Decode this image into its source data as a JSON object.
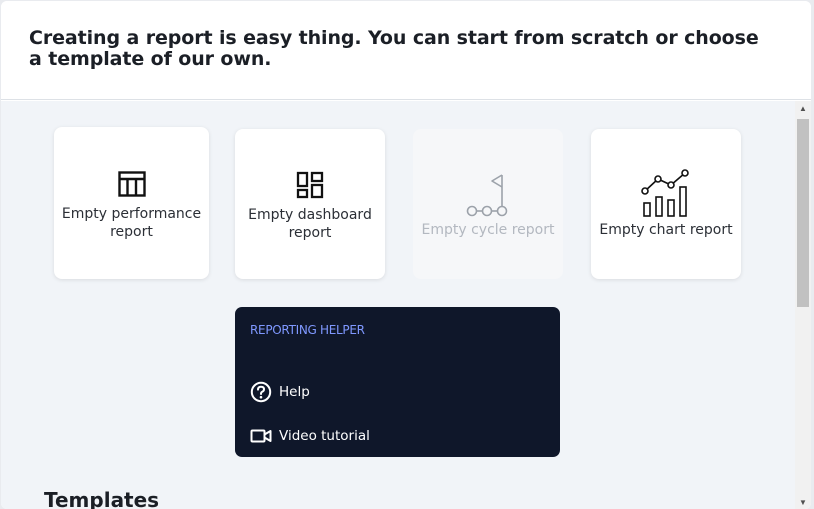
{
  "dialog": {
    "title": "Creating a report is easy thing. You can start from scratch or choose a template of our own."
  },
  "options": [
    {
      "label": "Empty performance report",
      "icon": "table-layout-icon",
      "enabled": true
    },
    {
      "label": "Empty dashboard report",
      "icon": "dashboard-grid-icon",
      "enabled": true
    },
    {
      "label": "Empty cycle report",
      "icon": "cycle-flag-icon",
      "enabled": false
    },
    {
      "label": "Empty chart report",
      "icon": "bar-line-chart-icon",
      "enabled": true
    }
  ],
  "helper": {
    "title": "REPORTING HELPER",
    "links": [
      {
        "label": "Help",
        "icon": "help-circle-icon"
      },
      {
        "label": "Video tutorial",
        "icon": "video-camera-icon"
      }
    ]
  },
  "templates": {
    "heading": "Templates"
  },
  "colors": {
    "helper_bg": "#0f172a",
    "helper_title": "#7f98ff",
    "body_bg": "#f1f4f8",
    "disabled_text": "#b3b8c0"
  }
}
